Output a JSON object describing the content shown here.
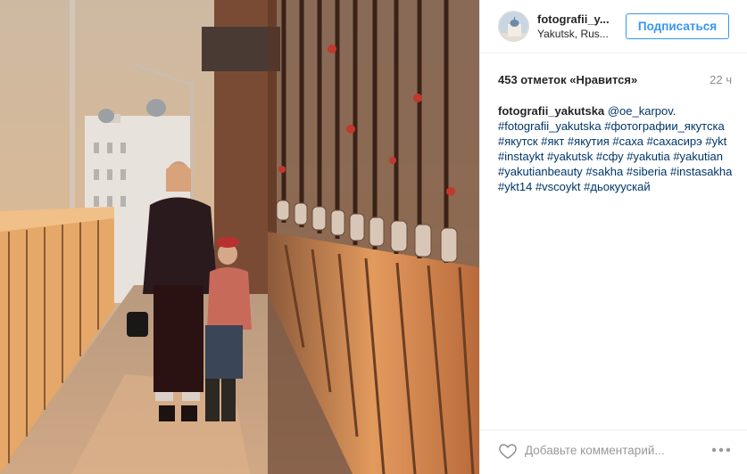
{
  "post": {
    "user": {
      "username": "fotografii_y...",
      "location": "Yakutsk, Rus...",
      "follow_label": "Подписаться"
    },
    "likes": "453 отметок «Нравится»",
    "time": "22 ч",
    "caption": {
      "author": "fotografii_yakutska",
      "mention": "@oe_karpov",
      "after_mention": ".",
      "tags": [
        "#fotografii_yakutska",
        "#фотографии_якутска",
        "#якутск",
        "#якт",
        "#якутия",
        "#саха",
        "#сахасирэ",
        "#ykt",
        "#instaykt",
        "#yakutsk",
        "#сфу",
        "#yakutia",
        "#yakutian",
        "#yakutianbeauty",
        "#sakha",
        "#siberia",
        "#instasakha",
        "#ykt14",
        "#vscoykt",
        "#дьокуускай"
      ]
    },
    "comment_placeholder": "Добавьте комментарий...",
    "icons": {
      "like": "heart-icon",
      "options": "more-options-icon"
    }
  }
}
